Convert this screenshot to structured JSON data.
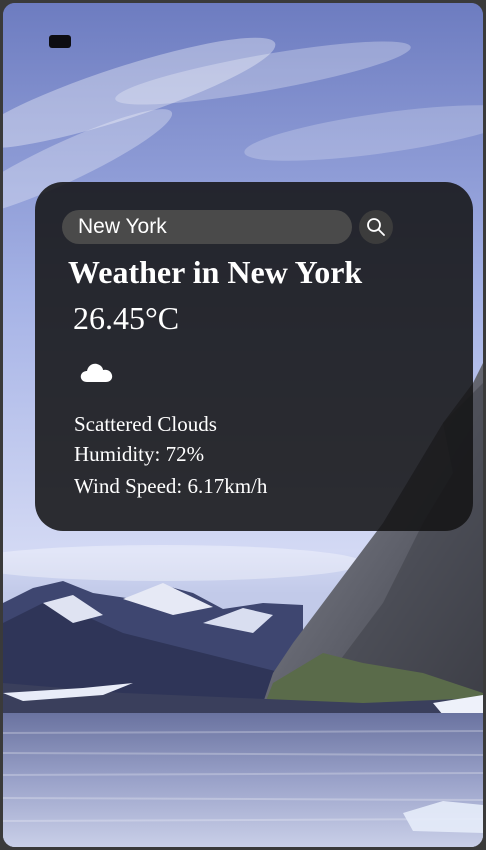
{
  "search": {
    "value": "New York"
  },
  "weather": {
    "title": "Weather in New York",
    "temperature": "26.45°C",
    "icon": "cloud-icon",
    "description": "Scattered Clouds",
    "humidity": "Humidity: 72%",
    "wind": "Wind Speed: 6.17km/h"
  },
  "icons": {
    "search": "search-icon",
    "menu": "menu-icon"
  }
}
